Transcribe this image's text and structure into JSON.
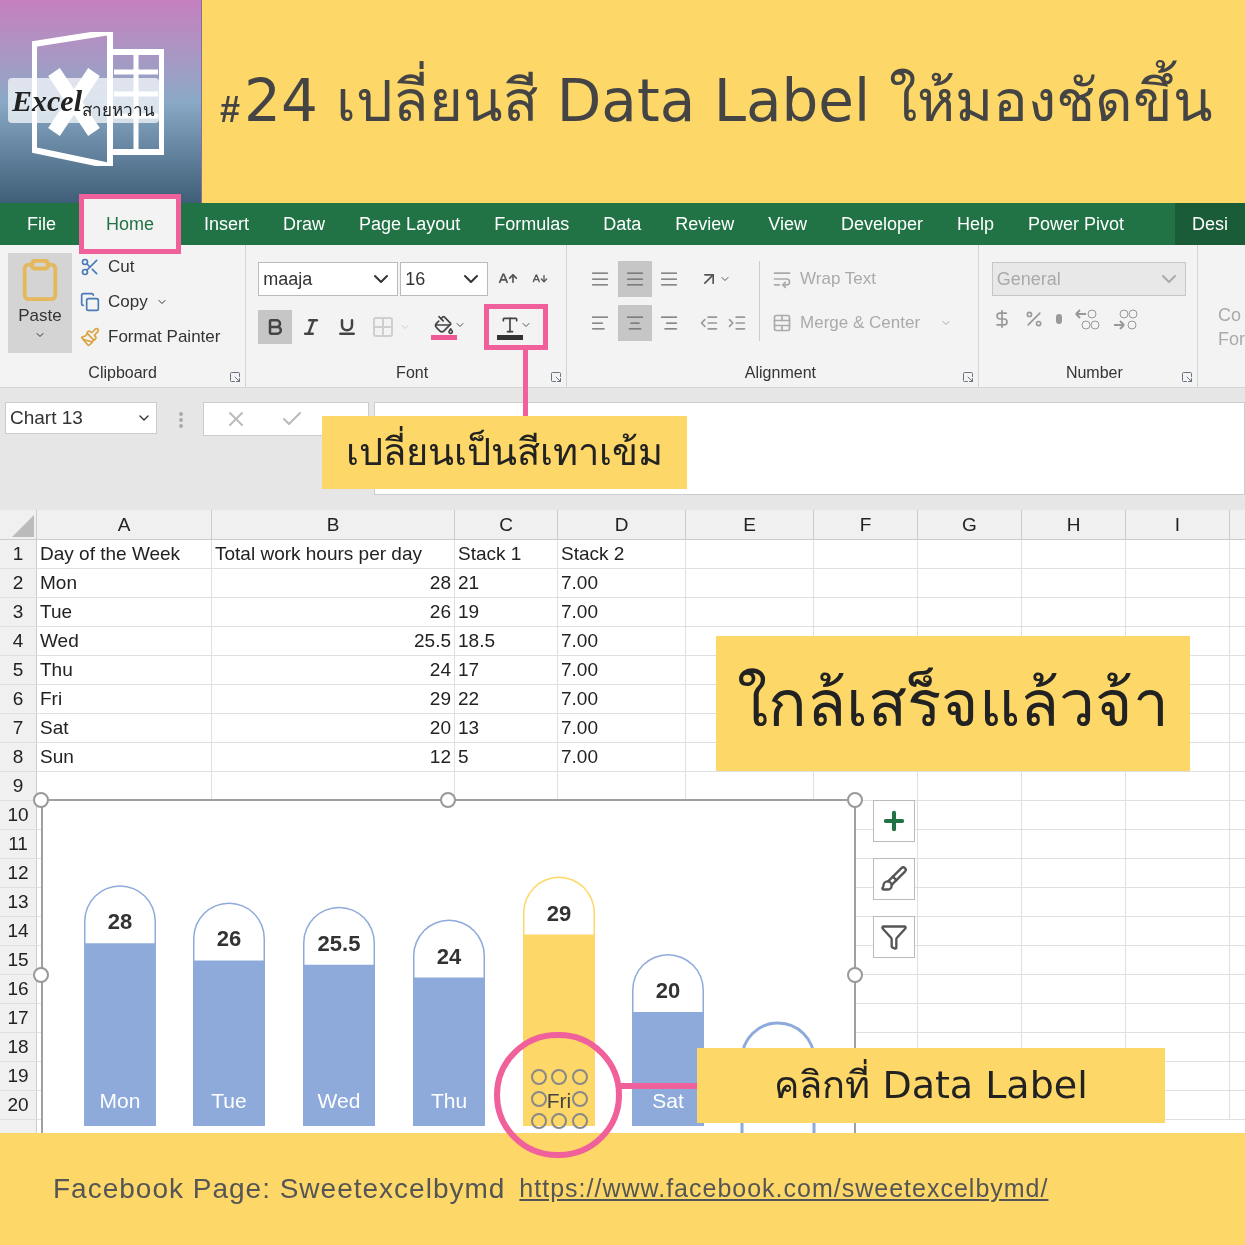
{
  "logo": {
    "word": "Excel",
    "thai": "สายหวาน"
  },
  "title": {
    "mark": "#",
    "text": "24 เปลี่ยนสี Data Label ให้มองชัดขึ้น"
  },
  "tabs": [
    {
      "label": "File",
      "selected": false,
      "highlighted": false
    },
    {
      "label": "Home",
      "selected": true,
      "highlighted": true
    },
    {
      "label": "Insert",
      "selected": false,
      "highlighted": false
    },
    {
      "label": "Draw",
      "selected": false,
      "highlighted": false
    },
    {
      "label": "Page Layout",
      "selected": false,
      "highlighted": false
    },
    {
      "label": "Formulas",
      "selected": false,
      "highlighted": false
    },
    {
      "label": "Data",
      "selected": false,
      "highlighted": false
    },
    {
      "label": "Review",
      "selected": false,
      "highlighted": false
    },
    {
      "label": "View",
      "selected": false,
      "highlighted": false
    },
    {
      "label": "Developer",
      "selected": false,
      "highlighted": false
    },
    {
      "label": "Help",
      "selected": false,
      "highlighted": false
    },
    {
      "label": "Power Pivot",
      "selected": false,
      "highlighted": false
    },
    {
      "label": "Desi",
      "selected": false,
      "highlighted": false
    }
  ],
  "clipboard": {
    "label": "Clipboard",
    "paste": "Paste",
    "items": [
      {
        "kind": "cut",
        "label": "Cut"
      },
      {
        "kind": "copy",
        "label": "Copy"
      },
      {
        "kind": "format-painter",
        "label": "Format Painter"
      }
    ]
  },
  "font": {
    "label": "Font",
    "font_name": "maaja",
    "font_size": "16",
    "buttons": [
      {
        "kind": "bold",
        "pressed": true
      },
      {
        "kind": "italic",
        "pressed": false
      },
      {
        "kind": "underline",
        "pressed": false
      },
      {
        "kind": "borders",
        "disabled": true
      },
      {
        "kind": "fill",
        "color": "#ef5a96",
        "highlighted": false
      },
      {
        "kind": "font-color",
        "color": "#333333",
        "highlighted": true
      }
    ]
  },
  "alignment": {
    "label": "Alignment",
    "buttons": [
      {
        "kind": "top",
        "pressed": false
      },
      {
        "kind": "middle",
        "pressed": true
      },
      {
        "kind": "bottom",
        "pressed": false
      },
      {
        "kind": "left",
        "pressed": false
      },
      {
        "kind": "center",
        "pressed": true
      },
      {
        "kind": "right",
        "pressed": false
      }
    ],
    "wrap_text": {
      "label": "Wrap Text",
      "disabled": true
    },
    "merge": {
      "label": "Merge & Center",
      "disabled": true
    }
  },
  "number": {
    "label": "Number",
    "format": {
      "value": "General",
      "disabled": true
    }
  },
  "next_group": {
    "lines": [
      "Co",
      "For"
    ]
  },
  "name_box": {
    "value": "Chart 13"
  },
  "callouts": [
    {
      "text": "เปลี่ยนเป็นสีเทาเข้ม"
    },
    {
      "text": "ใกล้เสร็จแล้วจ้า"
    },
    {
      "text": "คลิกที่ Data Label"
    }
  ],
  "sheet": {
    "columns": [
      "A",
      "B",
      "C",
      "D",
      "E",
      "F",
      "G",
      "H",
      "I"
    ],
    "rows": [
      {
        "number": "1",
        "cells": [
          "Day of the Week",
          "Total work hours per day",
          "Stack 1",
          "Stack 2"
        ]
      },
      {
        "number": "2",
        "cells": [
          "Mon",
          "28",
          "21",
          "7.00"
        ]
      },
      {
        "number": "3",
        "cells": [
          "Tue",
          "26",
          "19",
          "7.00"
        ]
      },
      {
        "number": "4",
        "cells": [
          "Wed",
          "25.5",
          "18.5",
          "7.00"
        ]
      },
      {
        "number": "5",
        "cells": [
          "Thu",
          "24",
          "17",
          "7.00"
        ]
      },
      {
        "number": "6",
        "cells": [
          "Fri",
          "29",
          "22",
          "7.00"
        ]
      },
      {
        "number": "7",
        "cells": [
          "Sat",
          "20",
          "13",
          "7.00"
        ]
      },
      {
        "number": "8",
        "cells": [
          "Sun",
          "12",
          "5",
          "7.00"
        ]
      }
    ],
    "empty_rows": [
      "9",
      "10",
      "11",
      "12",
      "13",
      "14",
      "15",
      "16",
      "17",
      "18",
      "19",
      "20"
    ]
  },
  "chart": {
    "points": [
      {
        "color": "#8eaadb",
        "selected": false
      },
      {
        "color": "#8eaadb",
        "selected": false
      },
      {
        "color": "#8eaadb",
        "selected": false
      },
      {
        "color": "#8eaadb",
        "selected": false
      },
      {
        "color": "#fdd868",
        "selected": true
      },
      {
        "color": "#8eaadb",
        "selected": false
      }
    ],
    "chart_data": {
      "type": "bar",
      "categories": [
        "Mon",
        "Tue",
        "Wed",
        "Thu",
        "Fri",
        "Sat"
      ],
      "values": [
        28,
        26,
        25.5,
        24,
        29,
        20
      ],
      "data_labels": true
    }
  },
  "footer": {
    "text": "Facebook Page: Sweetexcelbymd",
    "link": "https://www.facebook.com/sweetexcelbymd/"
  }
}
